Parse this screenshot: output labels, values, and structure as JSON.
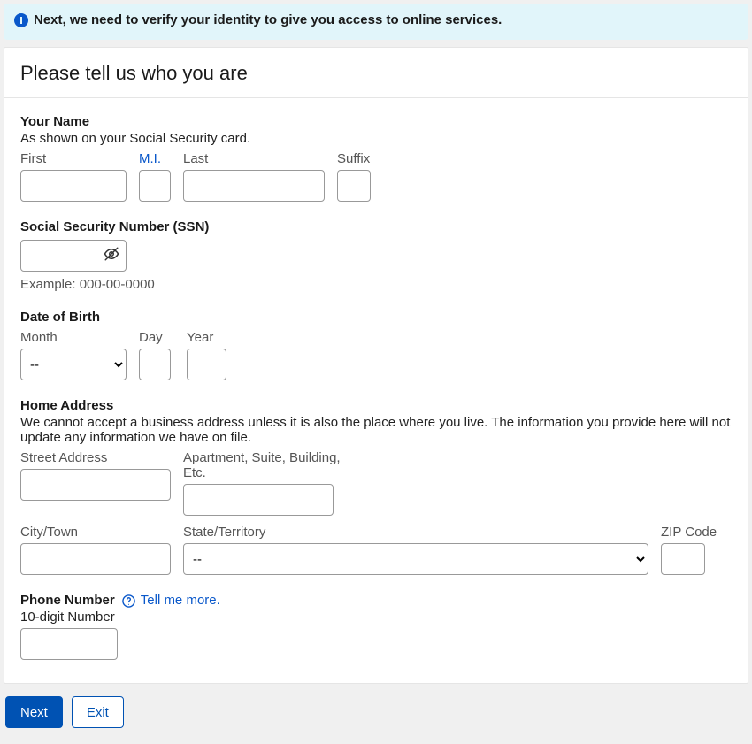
{
  "alert": {
    "text": "Next, we need to verify your identity to give you access to online services."
  },
  "heading": "Please tell us who you are",
  "name": {
    "title": "Your Name",
    "sub": "As shown on your Social Security card.",
    "first": "First",
    "mi": "M.I.",
    "last": "Last",
    "suffix": "Suffix"
  },
  "ssn": {
    "title": "Social Security Number (SSN)",
    "example": "Example: 000-00-0000"
  },
  "dob": {
    "title": "Date of Birth",
    "month": "Month",
    "day": "Day",
    "year": "Year",
    "month_default": "--"
  },
  "address": {
    "title": "Home Address",
    "sub": "We cannot accept a business address unless it is also the place where you live. The information you provide here will not update any information we have on file.",
    "street": "Street Address",
    "apt": "Apartment, Suite, Building, Etc.",
    "city": "City/Town",
    "state": "State/Territory",
    "zip": "ZIP Code",
    "state_default": "--"
  },
  "phone": {
    "title": "Phone Number",
    "tell_more": "Tell me more.",
    "label": "10-digit Number"
  },
  "buttons": {
    "next": "Next",
    "exit": "Exit"
  }
}
